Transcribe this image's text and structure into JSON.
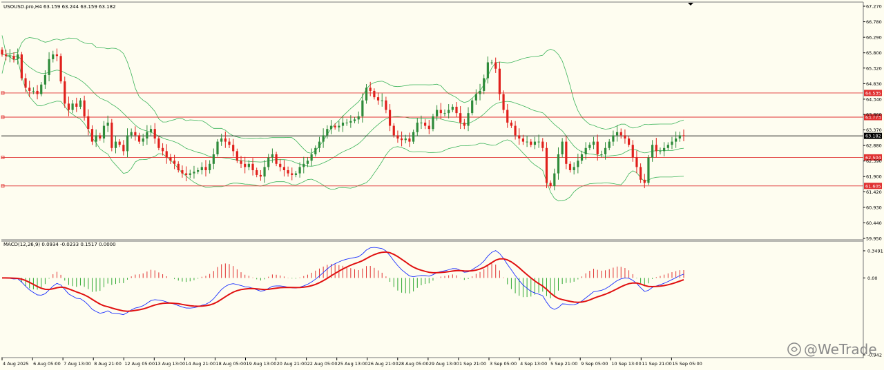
{
  "symbol_header": "USOUSD.pro,H4  63.159 63.244 63.159 63.182",
  "macd_header": "MACD(12,26,9) 0.0934 -0.0233 0.1517 0.0000",
  "watermark": "@WeTrade",
  "colors": {
    "background": "#fefdf0",
    "bull": "#2e8b3a",
    "bear": "#e0201c",
    "bands": "#3cb45a",
    "level_line": "#e03030",
    "current_line": "#000000",
    "macd_line": "#1a2fff",
    "signal_line": "#e01010",
    "hist_pos": "#e03030",
    "hist_neg": "#2ea832"
  },
  "chart_data": {
    "type": "candlestick",
    "price_axis": {
      "ticks": [
        "67.270",
        "66.780",
        "66.290",
        "65.800",
        "65.320",
        "64.830",
        "64.340",
        "63.860",
        "63.370",
        "62.880",
        "62.390",
        "61.900",
        "61.420",
        "60.930",
        "60.440",
        "59.950"
      ],
      "range": [
        59.95,
        67.27
      ]
    },
    "levels": [
      {
        "label": "64.535",
        "value": 64.535
      },
      {
        "label": "63.773",
        "value": 63.773
      },
      {
        "label": "62.504",
        "value": 62.504
      },
      {
        "label": "61.605",
        "value": 61.605
      }
    ],
    "current_price": {
      "label": "63.182",
      "value": 63.182
    },
    "time_axis": [
      "4 Aug 2025",
      "6 Aug 05:00",
      "7 Aug 13:00",
      "8 Aug 21:00",
      "12 Aug 05:00",
      "13 Aug 13:00",
      "14 Aug 21:00",
      "18 Aug 05:00",
      "19 Aug 13:00",
      "20 Aug 21:00",
      "22 Aug 05:00",
      "25 Aug 13:00",
      "26 Aug 21:00",
      "28 Aug 05:00",
      "29 Aug 13:00",
      "1 Sep 21:00",
      "3 Sep 05:00",
      "4 Sep 13:00",
      "5 Sep 21:00",
      "9 Sep 05:00",
      "10 Sep 13:00",
      "11 Sep 21:00",
      "15 Sep 05:00"
    ],
    "close_path": [
      65.75,
      65.7,
      65.7,
      65.6,
      65.75,
      65.0,
      64.7,
      64.6,
      64.6,
      64.5,
      64.8,
      65.1,
      65.6,
      65.75,
      65.7,
      64.9,
      64.2,
      64.0,
      64.2,
      64.1,
      64.3,
      63.8,
      63.4,
      63.0,
      63.2,
      63.1,
      63.5,
      63.6,
      62.8,
      63.0,
      62.9,
      62.7,
      63.2,
      63.3,
      63.2,
      63.0,
      63.1,
      63.3,
      63.4,
      63.1,
      62.8,
      62.7,
      62.5,
      62.4,
      62.3,
      62.1,
      62.0,
      61.95,
      62.0,
      62.05,
      62.1,
      62.2,
      62.1,
      62.3,
      62.6,
      63.0,
      63.1,
      63.0,
      62.9,
      62.7,
      62.4,
      62.3,
      62.2,
      62.3,
      62.1,
      61.95,
      61.9,
      62.2,
      62.5,
      62.6,
      62.3,
      62.2,
      62.1,
      62.0,
      61.95,
      62.0,
      62.2,
      62.3,
      62.4,
      62.6,
      62.8,
      63.0,
      63.2,
      63.4,
      63.5,
      63.45,
      63.5,
      63.6,
      63.6,
      63.65,
      63.7,
      63.8,
      64.3,
      64.7,
      64.6,
      64.4,
      64.3,
      64.3,
      64.0,
      63.5,
      63.2,
      63.1,
      63.05,
      63.1,
      63.0,
      63.3,
      63.6,
      63.6,
      63.5,
      63.4,
      63.8,
      64.0,
      63.9,
      63.9,
      64.0,
      64.1,
      63.9,
      63.6,
      63.5,
      63.9,
      64.3,
      64.5,
      64.6,
      65.0,
      65.5,
      65.5,
      65.3,
      64.5,
      64.0,
      63.6,
      63.5,
      63.2,
      63.1,
      63.0,
      63.0,
      62.9,
      63.0,
      63.0,
      62.8,
      61.7,
      61.6,
      62.0,
      62.6,
      63.0,
      62.3,
      62.1,
      62.2,
      62.4,
      62.6,
      62.8,
      62.9,
      63.0,
      62.6,
      62.6,
      62.8,
      63.0,
      63.2,
      63.3,
      63.2,
      63.1,
      62.9,
      62.5,
      62.2,
      61.8,
      61.7,
      62.5,
      62.9,
      62.7,
      62.7,
      62.8,
      62.9,
      63.0,
      63.1,
      63.2,
      63.18
    ],
    "macd_axis": {
      "top_label": "0.3491",
      "zero_label": "0.00",
      "bottom_label": "-0.942"
    }
  }
}
